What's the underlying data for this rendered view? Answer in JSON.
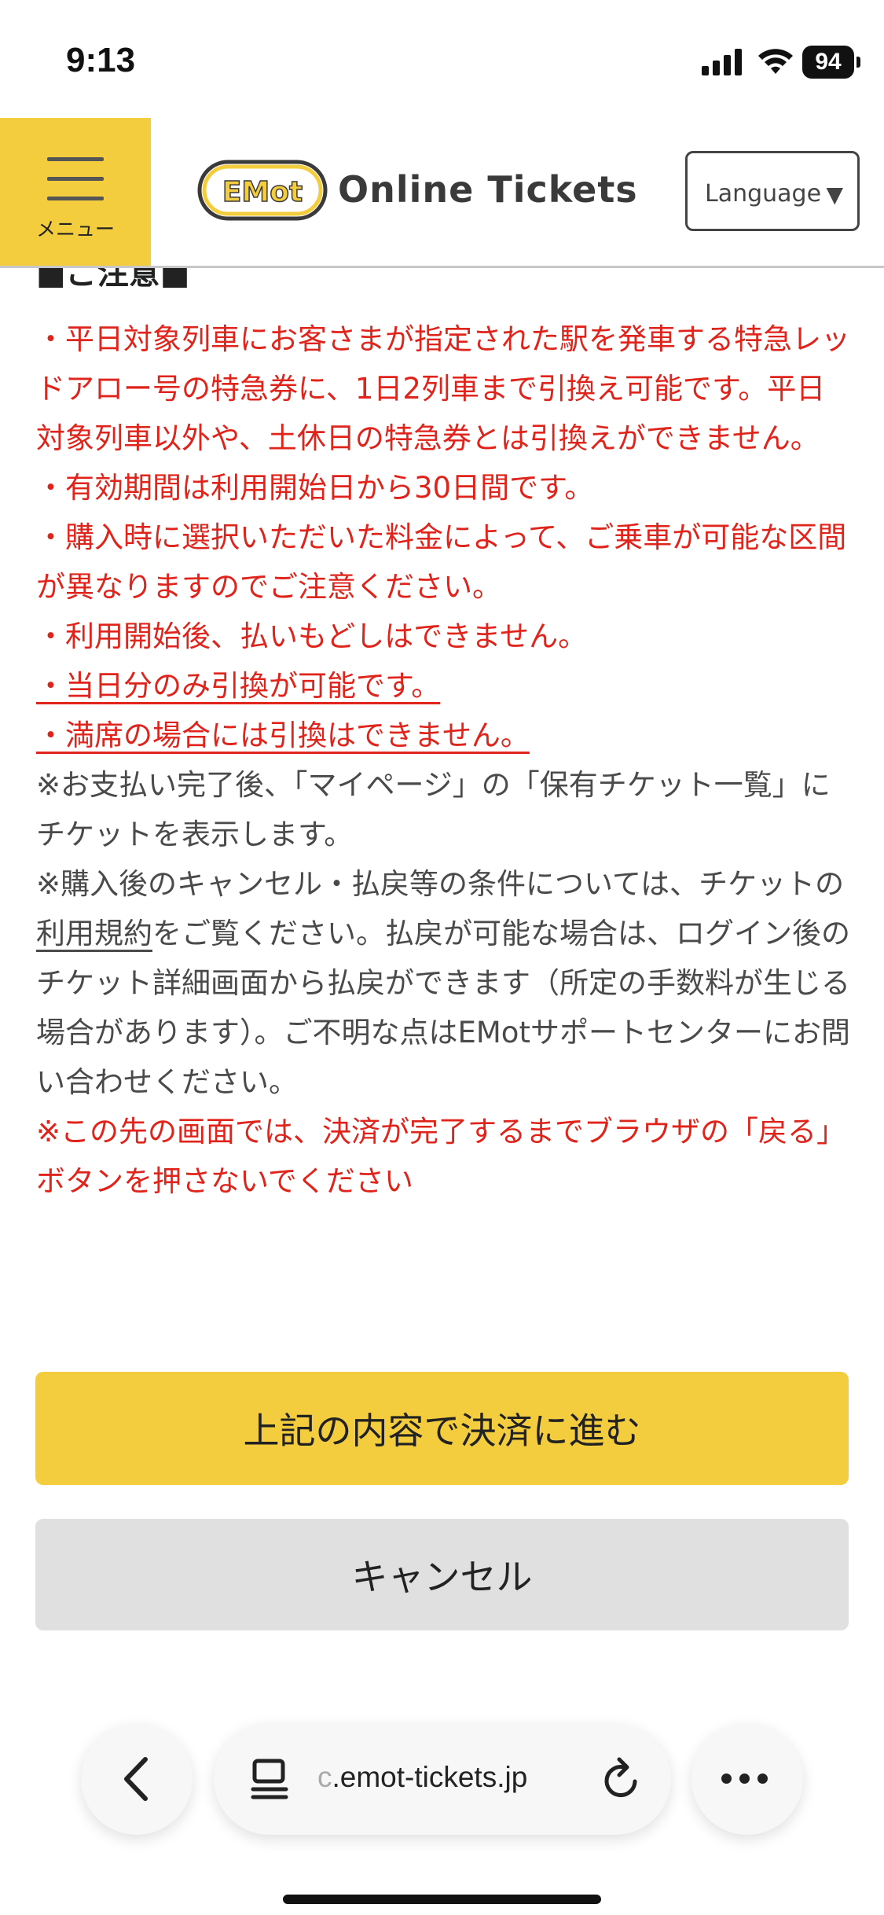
{
  "status_bar": {
    "time": "9:13",
    "battery": "94"
  },
  "header": {
    "menu_label": "メニュー",
    "logo_text": "EMot",
    "brand": "Online Tickets",
    "language_label": "Language",
    "language_caret": "▼"
  },
  "content": {
    "heading": "■ご注意■",
    "red_lines": [
      "・平日対象列車にお客さまが指定された駅を発車する特急レッドアロー号の特急券に、1日2列車まで引換え可能です。平日対象列車以外や、土休日の特急券とは引換えができません。",
      "・有効期間は利用開始日から30日間です。",
      "・購入時に選択いただいた料金によって、ご乗車が可能な区間が異なりますのでご注意ください。",
      "・利用開始後、払いもどしはできません。"
    ],
    "underlined_lines": [
      "・当日分のみ引換が可能です。",
      "・満席の場合には引換はできません。"
    ],
    "note1": "※お支払い完了後、「マイページ」の「保有チケット一覧」にチケットを表示します。",
    "note2_before": "※購入後のキャンセル・払戻等の条件については、チケットの",
    "note2_link": "利用規約",
    "note2_after": "をご覧ください。払戻が可能な場合は、ログイン後のチケット詳細画面から払戻ができます（所定の手数料が生じる場合があります）。ご不明な点はEMotサポートセンターにお問い合わせください。",
    "warning": "※この先の画面では、決済が完了するまでブラウザの「戻る」ボタンを押さないでください"
  },
  "buttons": {
    "proceed": "上記の内容で決済に進む",
    "cancel": "キャンセル"
  },
  "browser": {
    "url_prefix": "c",
    "url": ".emot-tickets.jp"
  }
}
